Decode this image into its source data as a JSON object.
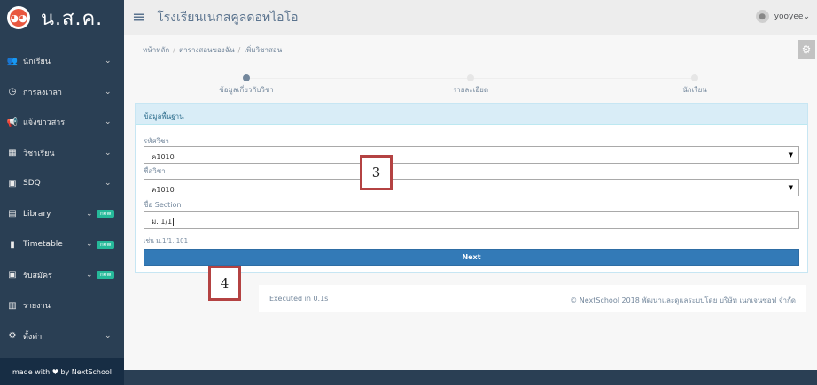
{
  "brand": {
    "logo_text": "ตูบ",
    "title": "น.ส.ค."
  },
  "sidebar": {
    "items": [
      {
        "label": "นักเรียน",
        "icon": "users-icon",
        "glyph": "👥",
        "badge": ""
      },
      {
        "label": "การลงเวลา",
        "icon": "clock-icon",
        "glyph": "◷",
        "badge": ""
      },
      {
        "label": "แจ้งข่าวสาร",
        "icon": "bullhorn-icon",
        "glyph": "📢",
        "badge": ""
      },
      {
        "label": "วิชาเรียน",
        "icon": "calendar-icon",
        "glyph": "▦",
        "badge": ""
      },
      {
        "label": "SDQ",
        "icon": "clipboard-icon",
        "glyph": "▣",
        "badge": ""
      },
      {
        "label": "Library",
        "icon": "book-icon",
        "glyph": "▤",
        "badge": "new"
      },
      {
        "label": "Timetable",
        "icon": "file-icon",
        "glyph": "▮",
        "badge": "new"
      },
      {
        "label": "รับสมัคร",
        "icon": "form-icon",
        "glyph": "▣",
        "badge": "new"
      },
      {
        "label": "รายงาน",
        "icon": "bar-chart-icon",
        "glyph": "▥",
        "badge": ""
      },
      {
        "label": "ตั้งค่า",
        "icon": "gears-icon",
        "glyph": "⚙",
        "badge": ""
      }
    ],
    "footer": "made with ♥ by NextSchool"
  },
  "topbar": {
    "menu_glyph": "≡",
    "school_name": "โรงเรียนเนกสคูลดอทไอโอ",
    "user_name": "yooyee",
    "user_caret": "⌄"
  },
  "breadcrumb": [
    "หน้าหลัก",
    "ตารางสอนของฉัน",
    "เพิ่มวิชาสอน"
  ],
  "wizard": {
    "steps": [
      "ข้อมูลเกี่ยวกับวิชา",
      "รายละเอียด",
      "นักเรียน"
    ],
    "active": 0
  },
  "panel": {
    "title": "ข้อมูลพื้นฐาน",
    "subject_code_label": "รหัสวิชา",
    "subject_code_value": "ค1010",
    "subject_name_label": "ชื่อวิชา",
    "subject_name_value": "ค1010",
    "section_label": "ชื่อ Section",
    "section_value": "ม. 1/1",
    "section_hint": "เช่น ม.1/1, 101",
    "next_label": "Next"
  },
  "footer": {
    "exec_time": "Executed in 0.1s",
    "copyright": "© NextSchool 2018 พัฒนาและดูแลระบบโดย บริษัท เนกเจนซอฟ จำกัด"
  },
  "callouts": [
    "3",
    "4"
  ],
  "colors": {
    "sidebar_bg": "#2a3f54",
    "accent_blue": "#337ab7",
    "badge_green": "#26b99a",
    "callout_border": "#b44242"
  }
}
